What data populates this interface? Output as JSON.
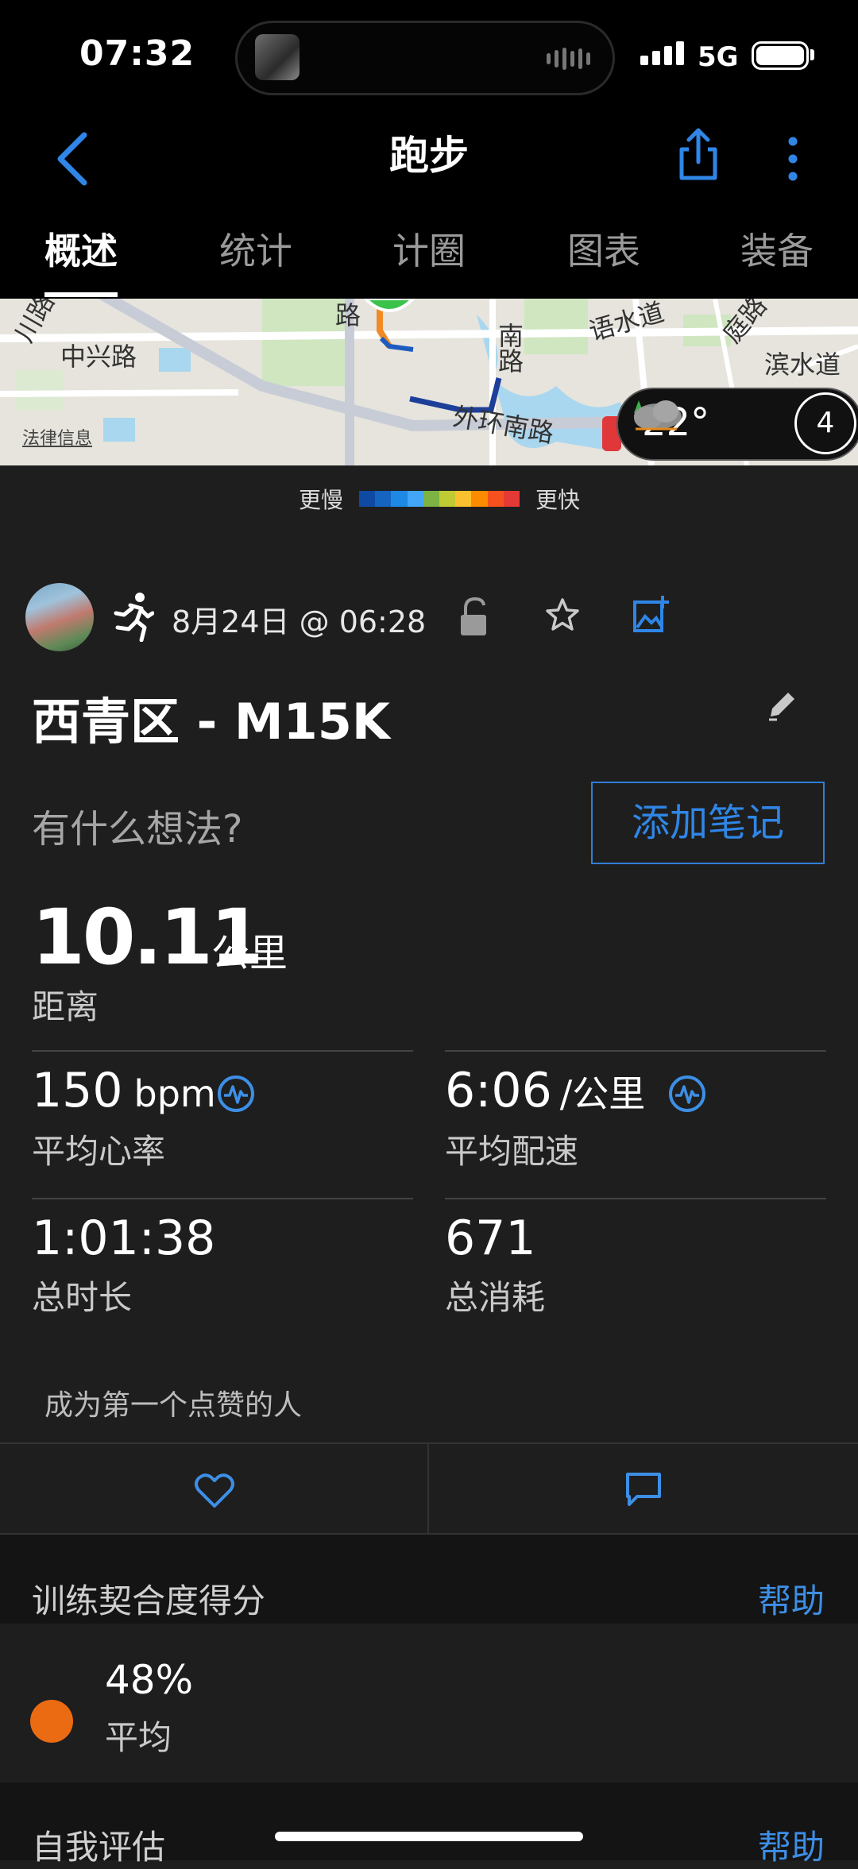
{
  "status_bar": {
    "time": "07:32",
    "network": "5G"
  },
  "header": {
    "title": "跑步"
  },
  "tabs": [
    {
      "label": "概述",
      "active": true
    },
    {
      "label": "统计",
      "active": false
    },
    {
      "label": "计圈",
      "active": false
    },
    {
      "label": "图表",
      "active": false
    },
    {
      "label": "装备",
      "active": false
    }
  ],
  "map": {
    "labels": [
      "中兴路",
      "外环南路",
      "滨水道",
      "语水道",
      "南路",
      "川路",
      "路",
      "庭路"
    ],
    "legal": "法律信息",
    "weather_temp": "22°",
    "wind_speed": "4"
  },
  "legend": {
    "slower": "更慢",
    "faster": "更快",
    "colors": [
      "#0e4aa3",
      "#1565c0",
      "#1e88e5",
      "#42a5f5",
      "#7cb342",
      "#c0ca33",
      "#fbc02d",
      "#fb8c00",
      "#f4511e",
      "#e53935"
    ]
  },
  "activity": {
    "date": "8月24日 @ 06:28",
    "title": "西青区 - M15K",
    "thoughts_prompt": "有什么想法?",
    "add_note": "添加笔记",
    "distance": {
      "value": "10.11",
      "unit": "公里",
      "label": "距离"
    },
    "avg_hr": {
      "value": "150",
      "unit": "bpm",
      "label": "平均心率"
    },
    "avg_pace": {
      "value": "6:06",
      "unit": "/公里",
      "label": "平均配速"
    },
    "duration": {
      "value": "1:01:38",
      "label": "总时长"
    },
    "calories": {
      "value": "671",
      "label": "总消耗"
    }
  },
  "social": {
    "likes_text": "成为第一个点赞的人"
  },
  "training_fitness": {
    "title": "训练契合度得分",
    "help": "帮助",
    "value": "48%",
    "label": "平均",
    "color": "#ea6b12"
  },
  "self_eval": {
    "title": "自我评估",
    "help": "帮助"
  },
  "accent": "#2f86e6"
}
